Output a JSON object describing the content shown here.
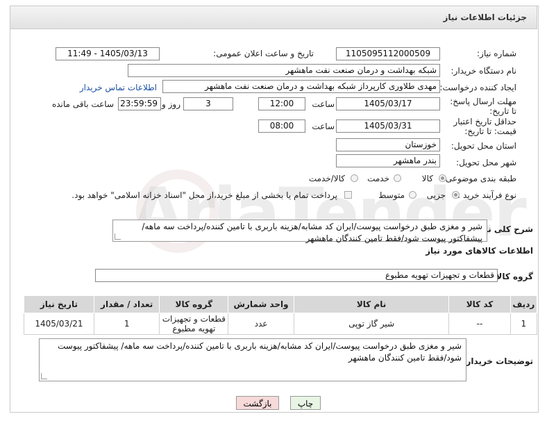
{
  "header": {
    "title": "جزئیات اطلاعات نیاز"
  },
  "fields": {
    "need_number_label": "شماره نیاز:",
    "need_number": "1105095112000509",
    "announce_label": "تاریخ و ساعت اعلان عمومی:",
    "announce_value": "1405/03/13 - 11:49",
    "buyer_org_label": "نام دستگاه خریدار:",
    "buyer_org": "شبکه بهداشت و درمان صنعت نفت ماهشهر",
    "requester_label": "ایجاد کننده درخواست:",
    "requester": "مهدی طلاوری کارپرداز شبکه بهداشت و درمان صنعت نفت ماهشهر",
    "contact_link": "اطلاعات تماس خریدار",
    "send_deadline_label": "مهلت ارسال پاسخ: تا تاریخ:",
    "send_deadline_date": "1405/03/17",
    "time_label": "ساعت",
    "send_deadline_time": "12:00",
    "days_value": "3",
    "days_label": "روز و",
    "remaining_time": "23:59:59",
    "remaining_label": "ساعت باقی مانده",
    "price_validity_label": "حداقل تاریخ اعتبار قیمت: تا تاریخ:",
    "price_validity_date": "1405/03/31",
    "time_label2": "ساعت",
    "price_validity_time": "08:00",
    "province_label": "استان محل تحویل:",
    "province": "خوزستان",
    "city_label": "شهر محل تحویل:",
    "city": "بندر ماهشهر",
    "category_label": "طبقه بندی موضوعی:",
    "category_options": [
      "کالا",
      "خدمت",
      "کالا/خدمت"
    ],
    "process_label": "نوع فرآیند خرید :",
    "process_options": [
      "جزیی",
      "متوسط"
    ],
    "payment_note": "پرداخت تمام یا بخشی از مبلغ خرید،از محل \"اسناد خزانه اسلامی\" خواهد بود.",
    "description_label": "شرح کلی نیاز:",
    "description": "شیر و مغزی طبق درخواست پیوست/ایران کد مشابه/هزینه باربری با تامین کننده/پرداخت سه ماهه/ پیشفاکتور پیوست شود/فقط تامین کنندگان ماهشهر"
  },
  "goods": {
    "section_title": "اطلاعات کالاهای مورد نیاز",
    "group_label": "گروه کالا:",
    "group_value": "قطعات و تجهیزات تهویه مطبوع",
    "columns": [
      "ردیف",
      "کد کالا",
      "نام کالا",
      "واحد شمارش",
      "گروه کالا",
      "تعداد / مقدار",
      "تاریخ نیاز"
    ],
    "rows": [
      [
        "1",
        "--",
        "شیر گاز توپی",
        "عدد",
        "قطعات و تجهیزات تهویه مطبوع",
        "1",
        "1405/03/21"
      ]
    ]
  },
  "buyer_notes": {
    "label": "توضیحات خریدار:",
    "text": "شیر و مغزی طبق درخواست پیوست/ایران کد مشابه/هزینه باربری با تامین کننده/پرداخت سه ماهه/ پیشفاکتور پیوست شود/فقط تامین کنندگان ماهشهر"
  },
  "buttons": {
    "print": "چاپ",
    "back": "بازگشت"
  },
  "colors": {
    "link": "#1a4fa3",
    "back_button": "#f7d9d9",
    "print_button": "#e8f5e4",
    "table_header": "#d8d8d8"
  }
}
